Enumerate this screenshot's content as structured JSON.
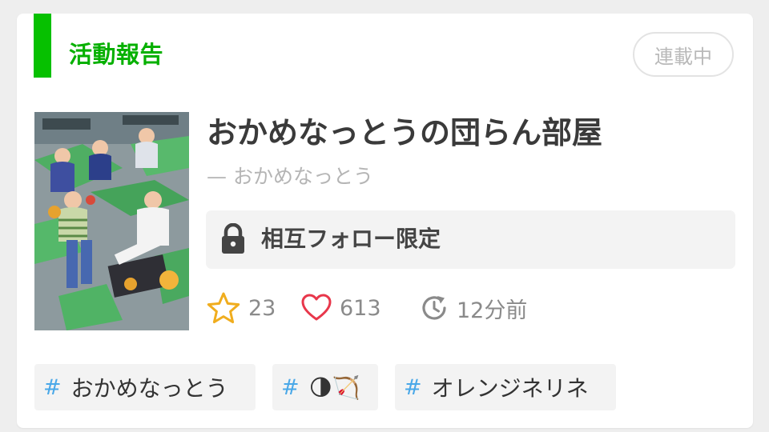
{
  "section": {
    "label": "活動報告"
  },
  "status": {
    "label": "連載中"
  },
  "story": {
    "title": "おかめなっとうの団らん部屋",
    "author": "— おかめなっとう",
    "cover_image": "cover-image"
  },
  "restriction": {
    "icon": "lock-icon",
    "label": "相互フォロー限定"
  },
  "stats": {
    "stars": {
      "icon": "star-icon",
      "value": "23"
    },
    "likes": {
      "icon": "heart-icon",
      "value": "613"
    },
    "updated": {
      "icon": "history-icon",
      "value": "12分前"
    }
  },
  "tags": [
    {
      "hash": "#",
      "label": "おかめなっとう"
    },
    {
      "hash": "#",
      "label": "🌗🏹"
    },
    {
      "hash": "#",
      "label": "オレンジネリネ"
    }
  ],
  "colors": {
    "accent": "#06c000",
    "star": "#f0ad1e",
    "heart": "#e8374b",
    "hash": "#4aa8e8"
  }
}
